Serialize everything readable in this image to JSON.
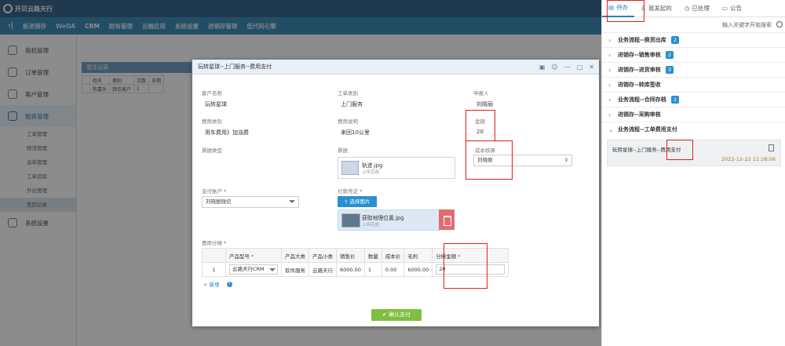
{
  "app": {
    "logo_text": "开贝云路天行"
  },
  "menu": {
    "items": [
      "新进销存",
      "WeOA",
      "CRM",
      "财务管理",
      "云端应用",
      "系统设置",
      "进销存管理",
      "低代码引擎"
    ],
    "active": "CRM"
  },
  "sidebar": {
    "items": [
      "商机管理",
      "订单管理",
      "客户管理",
      "服务管理"
    ],
    "sub_items": [
      "工单管理",
      "物流管理",
      "派单管理",
      "工单追踪",
      "外出管理",
      "签到记录"
    ],
    "bottom": "系统设置"
  },
  "background": {
    "subhead": "签注记录",
    "table_headers": [
      "",
      "姓名",
      "类别",
      "次数",
      "日期"
    ],
    "table_row": [
      "",
      "陈嘉乐",
      "拜访客户",
      "1",
      ""
    ]
  },
  "modal": {
    "title": "玩转星球--上门服务--费用支付",
    "customer_label": "客户名称",
    "customer_value": "玩转星球",
    "worktype_label": "工单类别",
    "worktype_value": "上门服务",
    "applicant_label": "申报人",
    "applicant_value": "刘晓丽",
    "feetype_label": "费用类别",
    "feetype_value": "用车费用》加油费",
    "feedesc_label": "费用说明",
    "feedesc_value": "来回10公里",
    "amount_label": "金额",
    "amount_value": "20",
    "cost_label": "成本核算",
    "cost_value": "刘晓丽",
    "invoice_type_label": "票据类型",
    "invoice_label": "票据",
    "invoice_file": "轨迹.jpg",
    "invoice_status": "上传完成",
    "pay_account_label": "支付账户",
    "pay_account_value": "刘晓丽微信",
    "voucher_label": "付款凭证",
    "choose_button": "选择图片",
    "voucher_file": "获取地理位置.jpg",
    "voucher_status": "上传完成",
    "alloc_label": "费用分摊",
    "alloc_headers": [
      "",
      "产品型号",
      "产品大类",
      "产品小类",
      "销售价",
      "数量",
      "成本价",
      "毛利",
      "分摊金额"
    ],
    "alloc_row": [
      "1",
      "云路天行CRM",
      "软件服务",
      "云路天行",
      "6000.00",
      "1",
      "0.00",
      "6000.00",
      "20"
    ],
    "add_label": "+ 新增",
    "help_symbol": "?",
    "confirm_button": "确认支付"
  },
  "right_panel": {
    "tabs": [
      "待办",
      "我发起的",
      "已处理",
      "公告"
    ],
    "search_placeholder": "输入关键字开始搜索",
    "items": [
      {
        "label": "业务流程--换货出库",
        "badge": "2",
        "chev": "›"
      },
      {
        "label": "进销存--销售审核",
        "badge": "2",
        "chev": "›"
      },
      {
        "label": "进销存--进货审核",
        "badge": "3",
        "chev": "›"
      },
      {
        "label": "进销存--转库签收",
        "badge": "",
        "chev": "›"
      },
      {
        "label": "业务流程--合同存档",
        "badge": "2",
        "chev": "›"
      },
      {
        "label": "进销存--采购审核",
        "badge": "",
        "chev": "›"
      },
      {
        "label": "业务流程--工单费用支付",
        "badge": "",
        "chev": "⌄"
      }
    ],
    "card_title": "玩转星球--上门服务--费用支付",
    "card_date": "2022-12-22 11:28:06"
  },
  "colors": {
    "accent": "#2a8fd1",
    "highlight": "#e0201b",
    "confirm": "#7fbf3f"
  }
}
